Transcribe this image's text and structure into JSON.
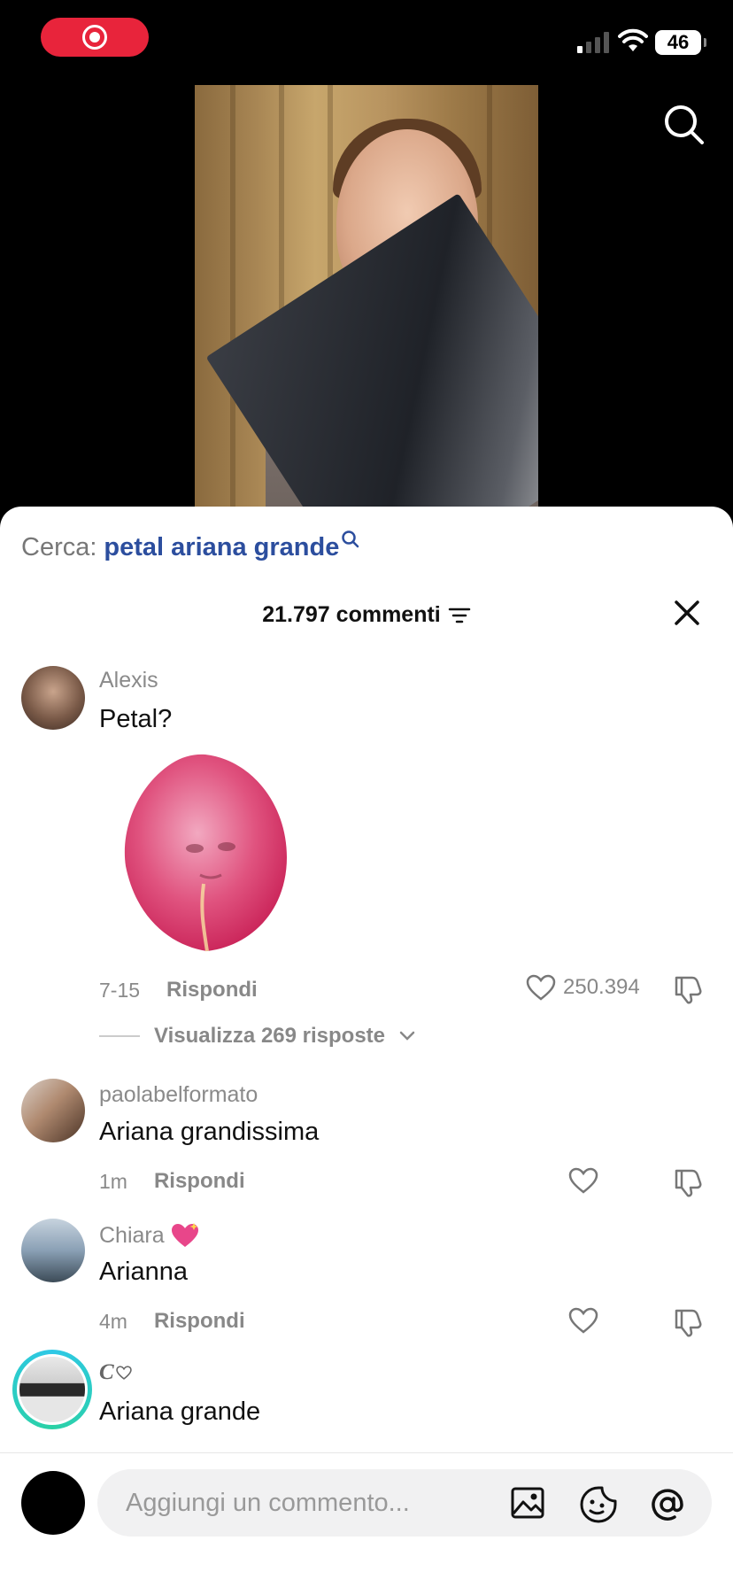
{
  "status_bar": {
    "battery": "46"
  },
  "search": {
    "prefix": "Cerca:",
    "term": "petal ariana grande"
  },
  "comments_header": {
    "count_label": "21.797 commenti"
  },
  "comments": [
    {
      "username": "Alexis",
      "text": "Petal?",
      "time": "7-15",
      "reply": "Rispondi",
      "likes": "250.394",
      "view_replies": "Visualizza 269 risposte"
    },
    {
      "username": "paolabelformato",
      "text": "Ariana grandissima",
      "time": "1m",
      "reply": "Rispondi"
    },
    {
      "username": "Chiara",
      "text": "Arianna",
      "time": "4m",
      "reply": "Rispondi"
    },
    {
      "username": "C",
      "text": "Ariana grande"
    }
  ],
  "composer": {
    "placeholder": "Aggiungi un commento..."
  },
  "colors": {
    "accent_search": "#2c4e9e",
    "record": "#e8243b"
  }
}
